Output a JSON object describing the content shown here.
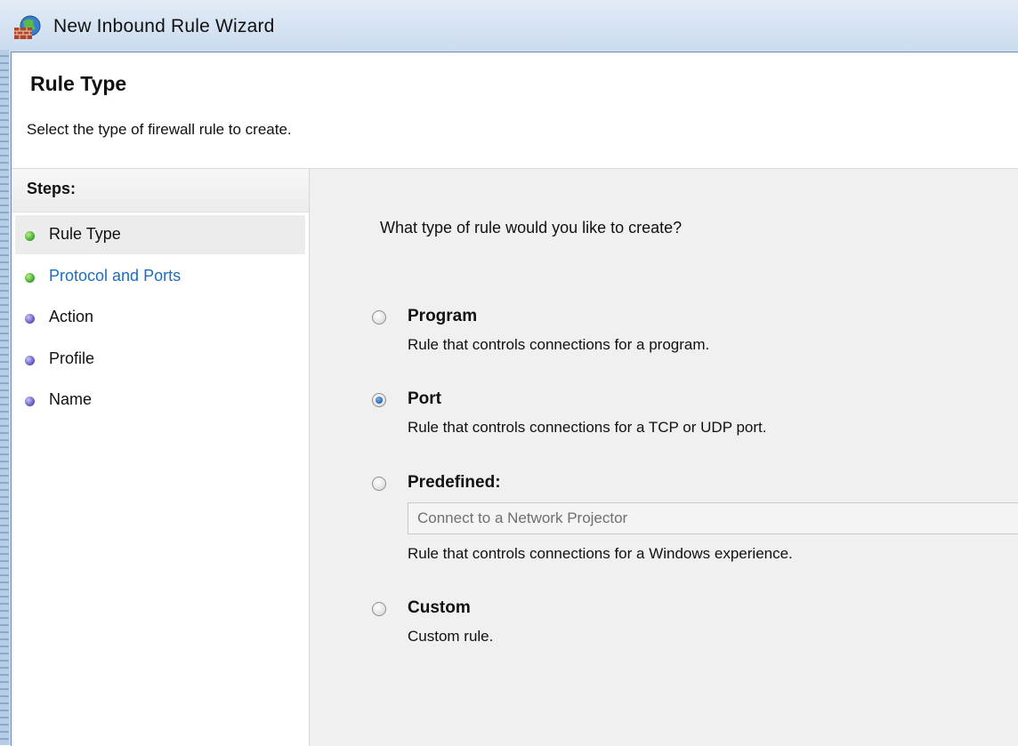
{
  "window": {
    "title": "New Inbound Rule Wizard",
    "icon": "firewall-globe-icon"
  },
  "header": {
    "title": "Rule Type",
    "subtitle": "Select the type of firewall rule to create."
  },
  "steps": {
    "heading": "Steps:",
    "items": [
      {
        "label": "Rule Type",
        "status": "done",
        "current": true
      },
      {
        "label": "Protocol and Ports",
        "status": "done",
        "current": false
      },
      {
        "label": "Action",
        "status": "todo",
        "current": false
      },
      {
        "label": "Profile",
        "status": "todo",
        "current": false
      },
      {
        "label": "Name",
        "status": "todo",
        "current": false
      }
    ]
  },
  "content": {
    "question": "What type of rule would you like to create?",
    "selected": "Port",
    "options": [
      {
        "title": "Program",
        "description": "Rule that controls connections for a program.",
        "checked": false
      },
      {
        "title": "Port",
        "description": "Rule that controls connections for a TCP or UDP port.",
        "checked": true
      },
      {
        "title": "Predefined:",
        "description": "Rule that controls connections for a Windows experience.",
        "checked": false,
        "dropdown_value": "Connect to a Network Projector"
      },
      {
        "title": "Custom",
        "description": "Custom rule.",
        "checked": false
      }
    ]
  },
  "colors": {
    "step_done": "#3aa22a",
    "step_todo": "#5a51c2",
    "link": "#1b6dbf",
    "content_bg": "#f0f0f0"
  }
}
